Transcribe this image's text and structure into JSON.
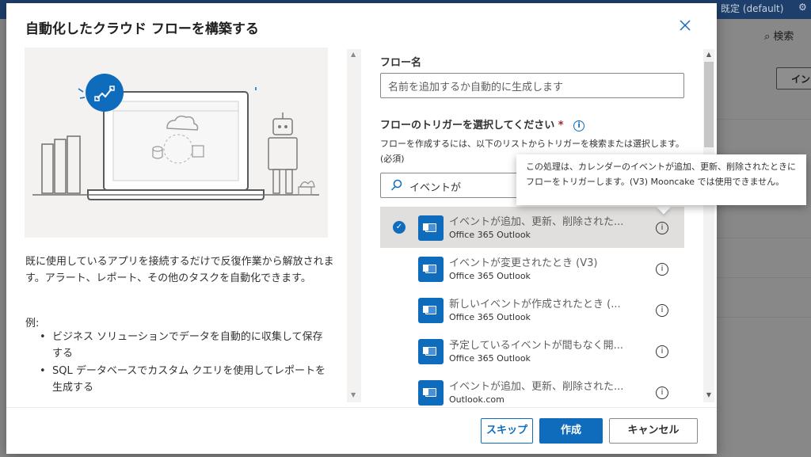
{
  "background": {
    "topbar_text": "既定 (default)",
    "search_label": "検索",
    "button_label": "イン"
  },
  "dialog": {
    "title": "自動化したクラウド フローを構築する",
    "description": "既に使用しているアプリを接続するだけで反復作業から解放されます。アラート、レポート、その他のタスクを自動化できます。",
    "example_label": "例:",
    "examples": [
      "ビジネス ソリューションでデータを自動的に収集して保存する",
      "SQL データベースでカスタム クエリを使用してレポートを生成する"
    ],
    "flow_name_label": "フロー名",
    "flow_name_placeholder": "名前を追加するか自動的に生成します",
    "trigger_label": "フローのトリガーを選択してください",
    "trigger_required": "*",
    "trigger_help": "フローを作成するには、以下のリストからトリガーを検索または選択します。(必須)",
    "search_value": "イベントが",
    "triggers": [
      {
        "name": "イベントが追加、更新、削除された...",
        "connector": "Office 365 Outlook",
        "selected": true
      },
      {
        "name": "イベントが変更されたとき (V3)",
        "connector": "Office 365 Outlook",
        "selected": false
      },
      {
        "name": "新しいイベントが作成されたとき (...",
        "connector": "Office 365 Outlook",
        "selected": false
      },
      {
        "name": "予定しているイベントが間もなく開...",
        "connector": "Office 365 Outlook",
        "selected": false
      },
      {
        "name": "イベントが追加、更新、削除された...",
        "connector": "Outlook.com",
        "selected": false
      }
    ],
    "tooltip": "この処理は、カレンダーのイベントが追加、更新、削除されたときにフローをトリガーします。(V3) Mooncake では使用できません。",
    "buttons": {
      "skip": "スキップ",
      "create": "作成",
      "cancel": "キャンセル"
    }
  },
  "colors": {
    "accent": "#0f6cbd",
    "selected_row": "#e1dfdd",
    "illustration_bg": "#f3f2f1"
  }
}
